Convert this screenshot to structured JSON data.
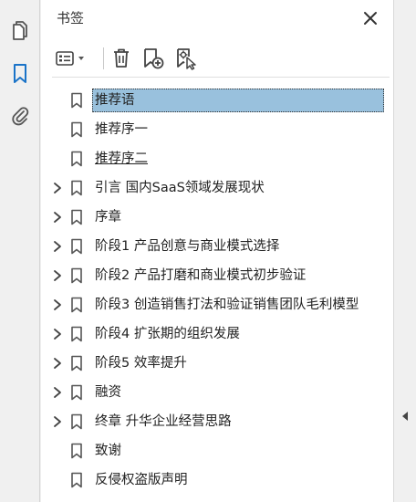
{
  "panel": {
    "title": "书签"
  },
  "rail": {
    "items": [
      {
        "icon": "pages-icon",
        "active": false
      },
      {
        "icon": "bookmark-icon",
        "active": true
      },
      {
        "icon": "attachment-icon",
        "active": false
      }
    ]
  },
  "toolbar": {
    "items": [
      "options-menu-icon",
      "delete-icon",
      "new-bookmark-icon",
      "new-bookmark-from-structure-icon"
    ]
  },
  "bookmarks": [
    {
      "label": "推荐语",
      "expandable": false,
      "selected": true
    },
    {
      "label": "推荐序一",
      "expandable": false
    },
    {
      "label": "推荐序二",
      "expandable": false,
      "underlined": true
    },
    {
      "label": "引言 国内SaaS领域发展现状",
      "expandable": true
    },
    {
      "label": "序章",
      "expandable": true
    },
    {
      "label": "阶段1 产品创意与商业模式选择",
      "expandable": true
    },
    {
      "label": "阶段2 产品打磨和商业模式初步验证",
      "expandable": true
    },
    {
      "label": "阶段3 创造销售打法和验证销售团队毛利模型",
      "expandable": true
    },
    {
      "label": "阶段4 扩张期的组织发展",
      "expandable": true
    },
    {
      "label": "阶段5 效率提升",
      "expandable": true
    },
    {
      "label": "融资",
      "expandable": true
    },
    {
      "label": "终章 升华企业经营思路",
      "expandable": true
    },
    {
      "label": "致谢",
      "expandable": false
    },
    {
      "label": "反侵权盗版声明",
      "expandable": false
    }
  ],
  "colors": {
    "accent": "#1a73c8",
    "selection": "#99c1dd",
    "icon": "#555555"
  }
}
